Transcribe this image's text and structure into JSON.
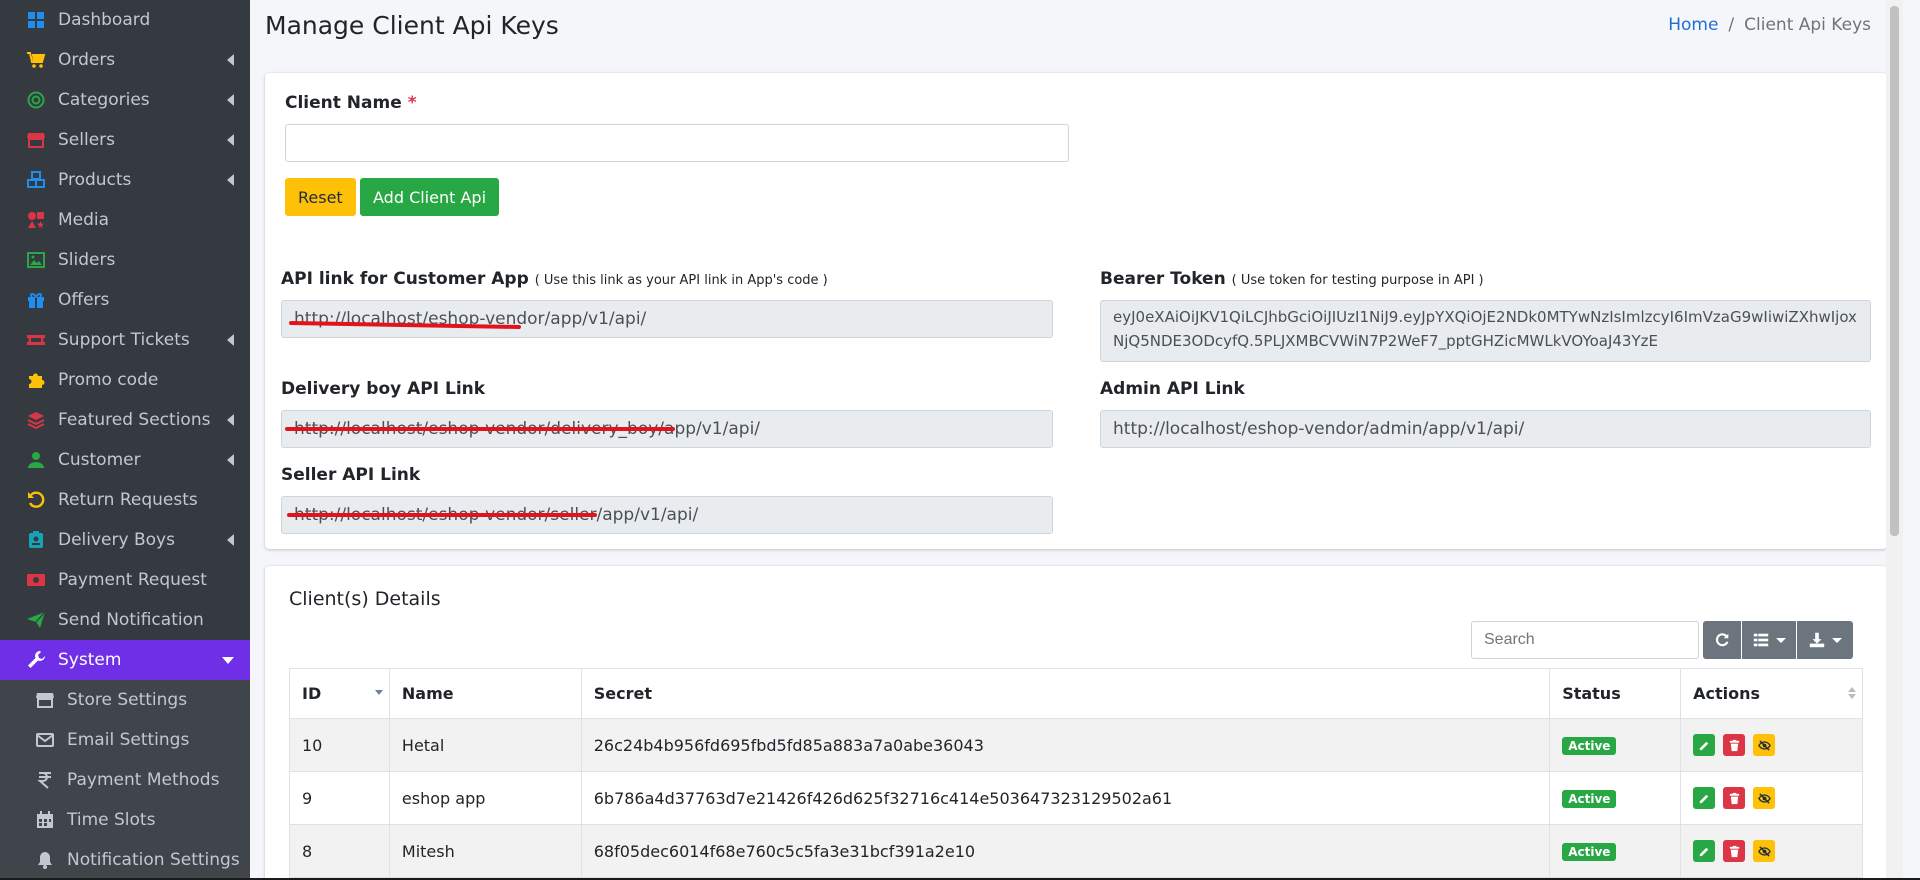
{
  "sidebar": {
    "items": [
      {
        "label": "Dashboard",
        "icon": "dashboard-icon",
        "color": "#1f8ef1",
        "submenu": false
      },
      {
        "label": "Orders",
        "icon": "cart-icon",
        "color": "#ffc107",
        "submenu": true
      },
      {
        "label": "Categories",
        "icon": "target-icon",
        "color": "#28a745",
        "submenu": true
      },
      {
        "label": "Sellers",
        "icon": "store-icon",
        "color": "#dc3545",
        "submenu": true
      },
      {
        "label": "Products",
        "icon": "cubes-icon",
        "color": "#1f8ef1",
        "submenu": true
      },
      {
        "label": "Media",
        "icon": "icons-icon",
        "color": "#dc3545",
        "submenu": false
      },
      {
        "label": "Sliders",
        "icon": "image-icon",
        "color": "#28a745",
        "submenu": false
      },
      {
        "label": "Offers",
        "icon": "gift-icon",
        "color": "#1f8ef1",
        "submenu": false
      },
      {
        "label": "Support Tickets",
        "icon": "ticket-icon",
        "color": "#dc3545",
        "submenu": true
      },
      {
        "label": "Promo code",
        "icon": "puzzle-icon",
        "color": "#ffc107",
        "submenu": false
      },
      {
        "label": "Featured Sections",
        "icon": "layers-icon",
        "color": "#dc3545",
        "submenu": true
      },
      {
        "label": "Customer",
        "icon": "user-icon",
        "color": "#28a745",
        "submenu": true
      },
      {
        "label": "Return Requests",
        "icon": "undo-icon",
        "color": "#ffc107",
        "submenu": false
      },
      {
        "label": "Delivery Boys",
        "icon": "id-badge-icon",
        "color": "#17a2b8",
        "submenu": true
      },
      {
        "label": "Payment Request",
        "icon": "money-icon",
        "color": "#dc3545",
        "submenu": false
      },
      {
        "label": "Send Notification",
        "icon": "paper-plane-icon",
        "color": "#28a745",
        "submenu": false
      },
      {
        "label": "System",
        "icon": "wrench-icon",
        "color": "#ffffff",
        "submenu": true,
        "active": true
      }
    ],
    "subitems": [
      {
        "label": "Store Settings",
        "icon": "store-icon"
      },
      {
        "label": "Email Settings",
        "icon": "envelope-icon"
      },
      {
        "label": "Payment Methods",
        "icon": "rupee-icon"
      },
      {
        "label": "Time Slots",
        "icon": "calendar-icon"
      },
      {
        "label": "Notification Settings",
        "icon": "bell-icon"
      }
    ]
  },
  "header": {
    "title": "Manage Client Api Keys",
    "breadcrumb_home": "Home",
    "breadcrumb_sep": "/",
    "breadcrumb_current": "Client Api Keys"
  },
  "form": {
    "client_name_label": "Client Name",
    "required_mark": "*",
    "client_name_value": "",
    "reset_label": "Reset",
    "add_label": "Add Client Api"
  },
  "links": {
    "customer_label": "API link for Customer App",
    "customer_hint": "( Use this link as your API link in App's code )",
    "customer_value": "http://localhost/eshop-vendor/app/v1/api/",
    "bearer_label": "Bearer Token",
    "bearer_hint": "( Use token for testing purpose in API )",
    "bearer_value": "eyJ0eXAiOiJKV1QiLCJhbGciOiJIUzI1NiJ9.eyJpYXQiOjE2NDk0MTYwNzIsImlzcyI6ImVzaG9wIiwiZXhwIjoxNjQ5NDE3ODcyfQ.5PLJXMBCVWiN7P2WeF7_pptGHZicMWLkVOYoaJ43YzE",
    "delivery_label": "Delivery boy API Link",
    "delivery_value": "http://localhost/eshop-vendor/delivery_boy/app/v1/api/",
    "admin_label": "Admin API Link",
    "admin_value": "http://localhost/eshop-vendor/admin/app/v1/api/",
    "seller_label": "Seller API Link",
    "seller_value": "http://localhost/eshop-vendor/seller/app/v1/api/"
  },
  "clients": {
    "title": "Client(s) Details",
    "search_placeholder": "Search",
    "columns": [
      "ID",
      "Name",
      "Secret",
      "Status",
      "Actions"
    ],
    "rows": [
      {
        "id": "10",
        "name": "Hetal",
        "secret": "26c24b4b956fd695fbd5fd85a883a7a0abe36043",
        "status": "Active"
      },
      {
        "id": "9",
        "name": "eshop app",
        "secret": "6b786a4d37763d7e21426f426d625f32716c414e503647323129502a61",
        "status": "Active"
      },
      {
        "id": "8",
        "name": "Mitesh",
        "secret": "68f05dec6014f68e760c5c5fa3e31bcf391a2e10",
        "status": "Active"
      }
    ]
  }
}
